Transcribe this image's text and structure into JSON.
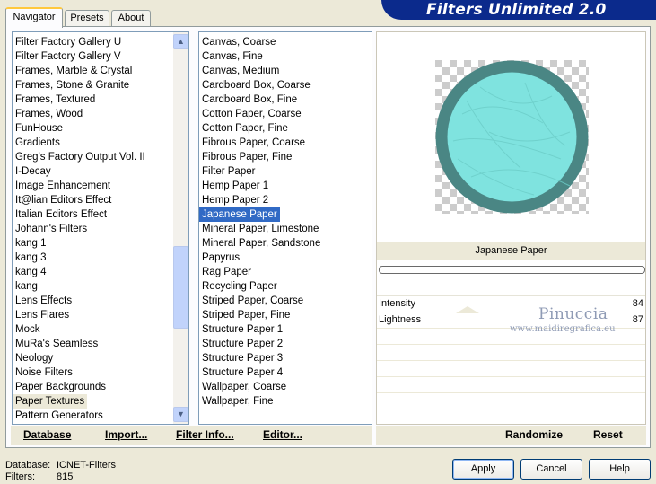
{
  "app": {
    "title": "Filters Unlimited 2.0"
  },
  "tabs": [
    {
      "label": "Navigator",
      "active": true
    },
    {
      "label": "Presets",
      "active": false
    },
    {
      "label": "About",
      "active": false
    }
  ],
  "categories": {
    "items": [
      "Filter Factory Gallery U",
      "Filter Factory Gallery V",
      "Frames, Marble & Crystal",
      "Frames, Stone & Granite",
      "Frames, Textured",
      "Frames, Wood",
      "FunHouse",
      "Gradients",
      "Greg's Factory Output Vol. II",
      "I-Decay",
      "Image Enhancement",
      "It@lian Editors Effect",
      "Italian Editors Effect",
      "Johann's Filters",
      "kang 1",
      "kang 3",
      "kang 4",
      "kang",
      "Lens Effects",
      "Lens Flares",
      "Mock",
      "MuRa's Seamless",
      "Neology",
      "Noise Filters",
      "Paper Backgrounds",
      "Paper Textures",
      "Pattern Generators"
    ],
    "selected": "Paper Textures"
  },
  "filters": {
    "items": [
      "Canvas, Coarse",
      "Canvas, Fine",
      "Canvas, Medium",
      "Cardboard Box, Coarse",
      "Cardboard Box, Fine",
      "Cotton Paper, Coarse",
      "Cotton Paper, Fine",
      "Fibrous Paper, Coarse",
      "Fibrous Paper, Fine",
      "Filter Paper",
      "Hemp Paper 1",
      "Hemp Paper 2",
      "Japanese Paper",
      "Mineral Paper, Limestone",
      "Mineral Paper, Sandstone",
      "Papyrus",
      "Rag Paper",
      "Recycling Paper",
      "Striped Paper, Coarse",
      "Striped Paper, Fine",
      "Structure Paper 1",
      "Structure Paper 2",
      "Structure Paper 3",
      "Structure Paper 4",
      "Wallpaper, Coarse",
      "Wallpaper, Fine"
    ],
    "selected": "Japanese Paper"
  },
  "preview": {
    "filter_name": "Japanese Paper",
    "circle_color": "#7fe3df",
    "ring_color": "#4a8684",
    "watermark_name": "Pinuccia",
    "watermark_url": "www.maidiregrafica.eu"
  },
  "controls": [
    {
      "label": "Intensity",
      "value": "84"
    },
    {
      "label": "Lightness",
      "value": "87"
    }
  ],
  "actions": {
    "database": "Database",
    "import": "Import...",
    "filter_info": "Filter Info...",
    "editor": "Editor...",
    "randomize": "Randomize",
    "reset": "Reset"
  },
  "status": {
    "database_label": "Database:",
    "database_value": "ICNET-Filters",
    "filters_label": "Filters:",
    "filters_value": "815"
  },
  "buttons": {
    "apply": "Apply",
    "cancel": "Cancel",
    "help": "Help"
  }
}
